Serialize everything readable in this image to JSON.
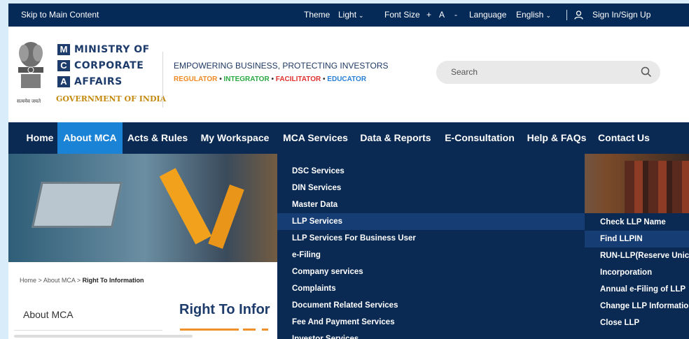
{
  "topbar": {
    "skip": "Skip to Main Content",
    "theme_label": "Theme",
    "theme_value": "Light",
    "font_label": "Font Size",
    "font_plus": "+",
    "font_a": "A",
    "font_minus": "-",
    "language_label": "Language",
    "language_value": "English",
    "signin": "Sign In/Sign Up",
    "icons": {
      "caret": "chevron-down-icon",
      "user": "user-icon"
    }
  },
  "header": {
    "brand": {
      "l1": "M",
      "w1": "MINISTRY OF",
      "l2": "C",
      "w2": "CORPORATE",
      "l3": "A",
      "w3": "AFFAIRS"
    },
    "gov": "GOVERNMENT OF INDIA",
    "motto": "सत्यमेव जयते",
    "tagline": "EMPOWERING BUSINESS, PROTECTING INVESTORS",
    "subtags": {
      "regulator": "REGULATOR",
      "integrator": "INTEGRATOR",
      "facilitator": "FACILITATOR",
      "educator": "EDUCATOR",
      "dot": "•"
    },
    "colors": {
      "regulator": "#f08a24",
      "integrator": "#2aa843",
      "facilitator": "#e0312f",
      "educator": "#2a7fd4"
    },
    "search": {
      "placeholder": "Search",
      "icon": "search-icon"
    }
  },
  "nav": {
    "items": [
      "Home",
      "About MCA",
      "Acts & Rules",
      "My Workspace",
      "MCA Services",
      "Data & Reports",
      "E-Consultation",
      "Help & FAQs",
      "Contact Us"
    ],
    "active": "About MCA",
    "colors": {
      "bg": "#0a2a53",
      "active": "#1a83d6"
    }
  },
  "dropdown": {
    "items": [
      "DSC Services",
      "DIN Services",
      "Master Data",
      "LLP Services",
      "LLP Services For Business User",
      "e-Filing",
      "Company services",
      "Complaints",
      "Document Related Services",
      "Fee And Payment Services",
      "Investor Services"
    ],
    "highlighted": "LLP Services"
  },
  "submenu": {
    "items": [
      "Check LLP Name",
      "Find LLPIN",
      "RUN-LLP(Reserve Unic",
      "Incorporation",
      "Annual e-Filing of LLP",
      "Change LLP Informatio",
      "Close LLP"
    ],
    "highlighted": "Find LLPIN"
  },
  "breadcrumb": {
    "home": "Home",
    "sep": ">",
    "about": "About MCA",
    "current": "Right To Information"
  },
  "sidebar": {
    "about": "About MCA"
  },
  "page": {
    "title": "Right To Infor"
  }
}
